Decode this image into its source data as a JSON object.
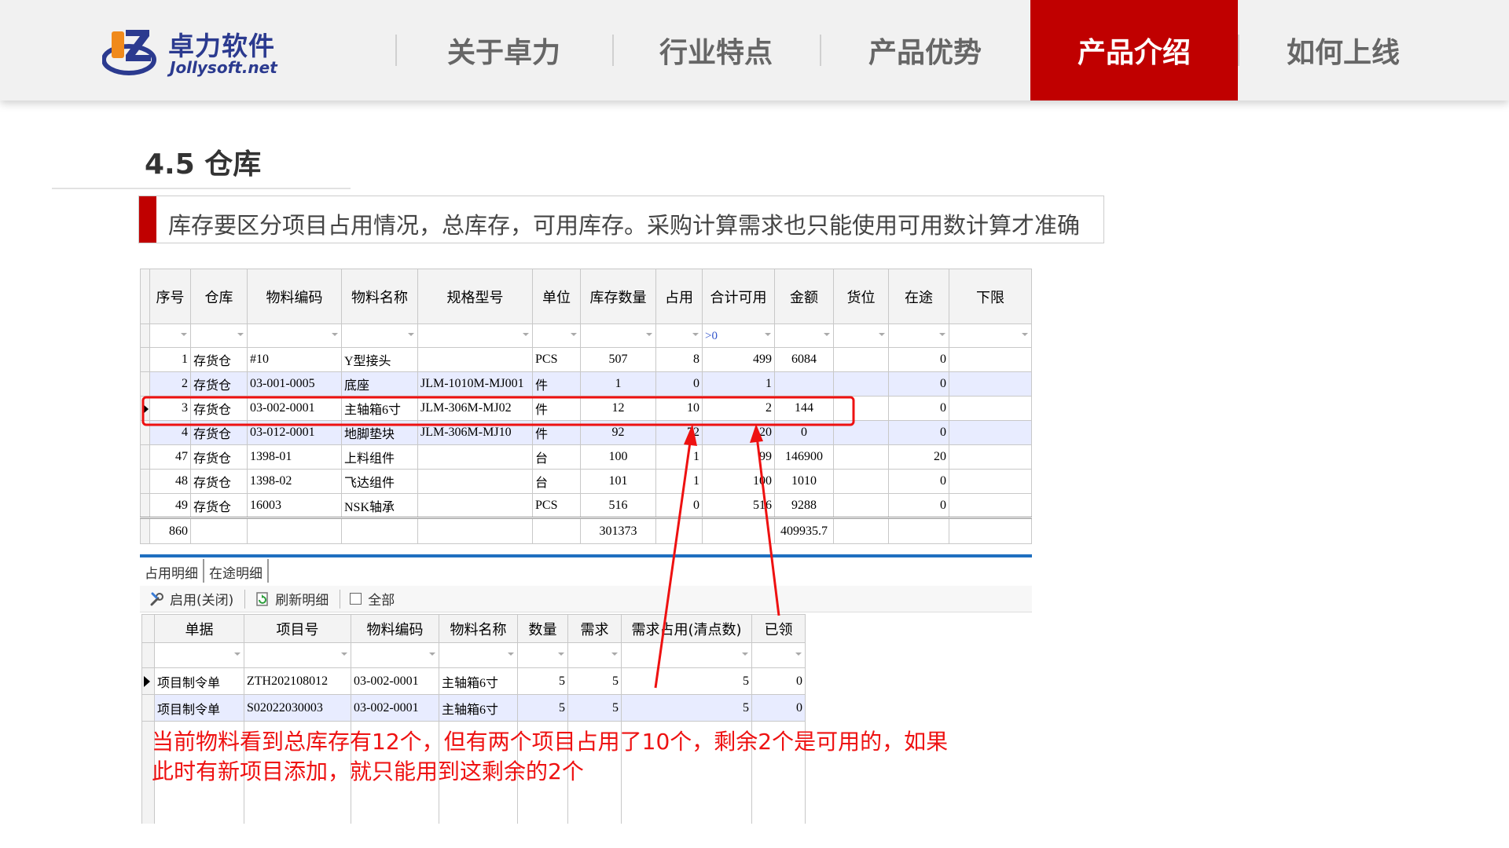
{
  "header": {
    "logo": {
      "cn": "卓力软件",
      "en": "Jollysoft.net"
    },
    "nav": [
      {
        "label": "关于卓力",
        "active": false
      },
      {
        "label": "行业特点",
        "active": false
      },
      {
        "label": "产品优势",
        "active": false
      },
      {
        "label": "产品介绍",
        "active": true
      },
      {
        "label": "如何上线",
        "active": false
      }
    ],
    "accent": "#c00000"
  },
  "section": {
    "title": "4.5 仓库",
    "note": "库存要区分项目占用情况，总库存，可用库存。采购计算需求也只能使用可用数计算才准确"
  },
  "grid": {
    "headers": [
      "序号",
      "仓库",
      "物料编码",
      "物料名称",
      "规格型号",
      "单位",
      "库存数量",
      "占用",
      "合计可用",
      "金额",
      "货位",
      "在途",
      "下限"
    ],
    "filter_value": ">0",
    "rows": [
      [
        "1",
        "存货仓",
        "#10",
        "Y型接头",
        "",
        "PCS",
        "507",
        "8",
        "499",
        "6084",
        "",
        "0",
        ""
      ],
      [
        "2",
        "存货仓",
        "03-001-0005",
        "底座",
        "JLM-1010M-MJ001",
        "件",
        "1",
        "0",
        "1",
        "",
        "",
        "0",
        ""
      ],
      [
        "3",
        "存货仓",
        "03-002-0001",
        "主轴箱6寸",
        "JLM-306M-MJ02",
        "件",
        "12",
        "10",
        "2",
        "144",
        "",
        "0",
        ""
      ],
      [
        "4",
        "存货仓",
        "03-012-0001",
        "地脚垫块",
        "JLM-306M-MJ10",
        "件",
        "92",
        "72",
        "20",
        "0",
        "",
        "0",
        ""
      ],
      [
        "47",
        "存货仓",
        "1398-01",
        "上料组件",
        "",
        "台",
        "100",
        "1",
        "99",
        "146900",
        "",
        "20",
        ""
      ],
      [
        "48",
        "存货仓",
        "1398-02",
        "飞达组件",
        "",
        "台",
        "101",
        "1",
        "100",
        "1010",
        "",
        "0",
        ""
      ],
      [
        "49",
        "存货仓",
        "16003",
        "NSK轴承",
        "",
        "PCS",
        "516",
        "0",
        "516",
        "9288",
        "",
        "0",
        ""
      ]
    ],
    "totals": {
      "count": "860",
      "stock": "301373",
      "amount": "409935.7"
    }
  },
  "tabs": [
    "占用明细",
    "在途明细"
  ],
  "toolbar": {
    "enable": "启用(关闭)",
    "refresh": "刷新明细",
    "all": "全部"
  },
  "grid2": {
    "headers": [
      "单据",
      "项目号",
      "物料编码",
      "物料名称",
      "数量",
      "需求",
      "需求占用(清点数)",
      "已领"
    ],
    "rows": [
      [
        "项目制令单",
        "ZTH202108012",
        "03-002-0001",
        "主轴箱6寸",
        "5",
        "5",
        "5",
        "0"
      ],
      [
        "项目制令单",
        "S02022030003",
        "03-002-0001",
        "主轴箱6寸",
        "5",
        "5",
        "5",
        "0"
      ]
    ]
  },
  "annotation": {
    "line1": "当前物料看到总库存有12个，但有两个项目占用了10个，剩余2个是可用的，如果",
    "line2": "此时有新项目添加，就只能用到这剩余的2个",
    "color": "#ee1111"
  }
}
